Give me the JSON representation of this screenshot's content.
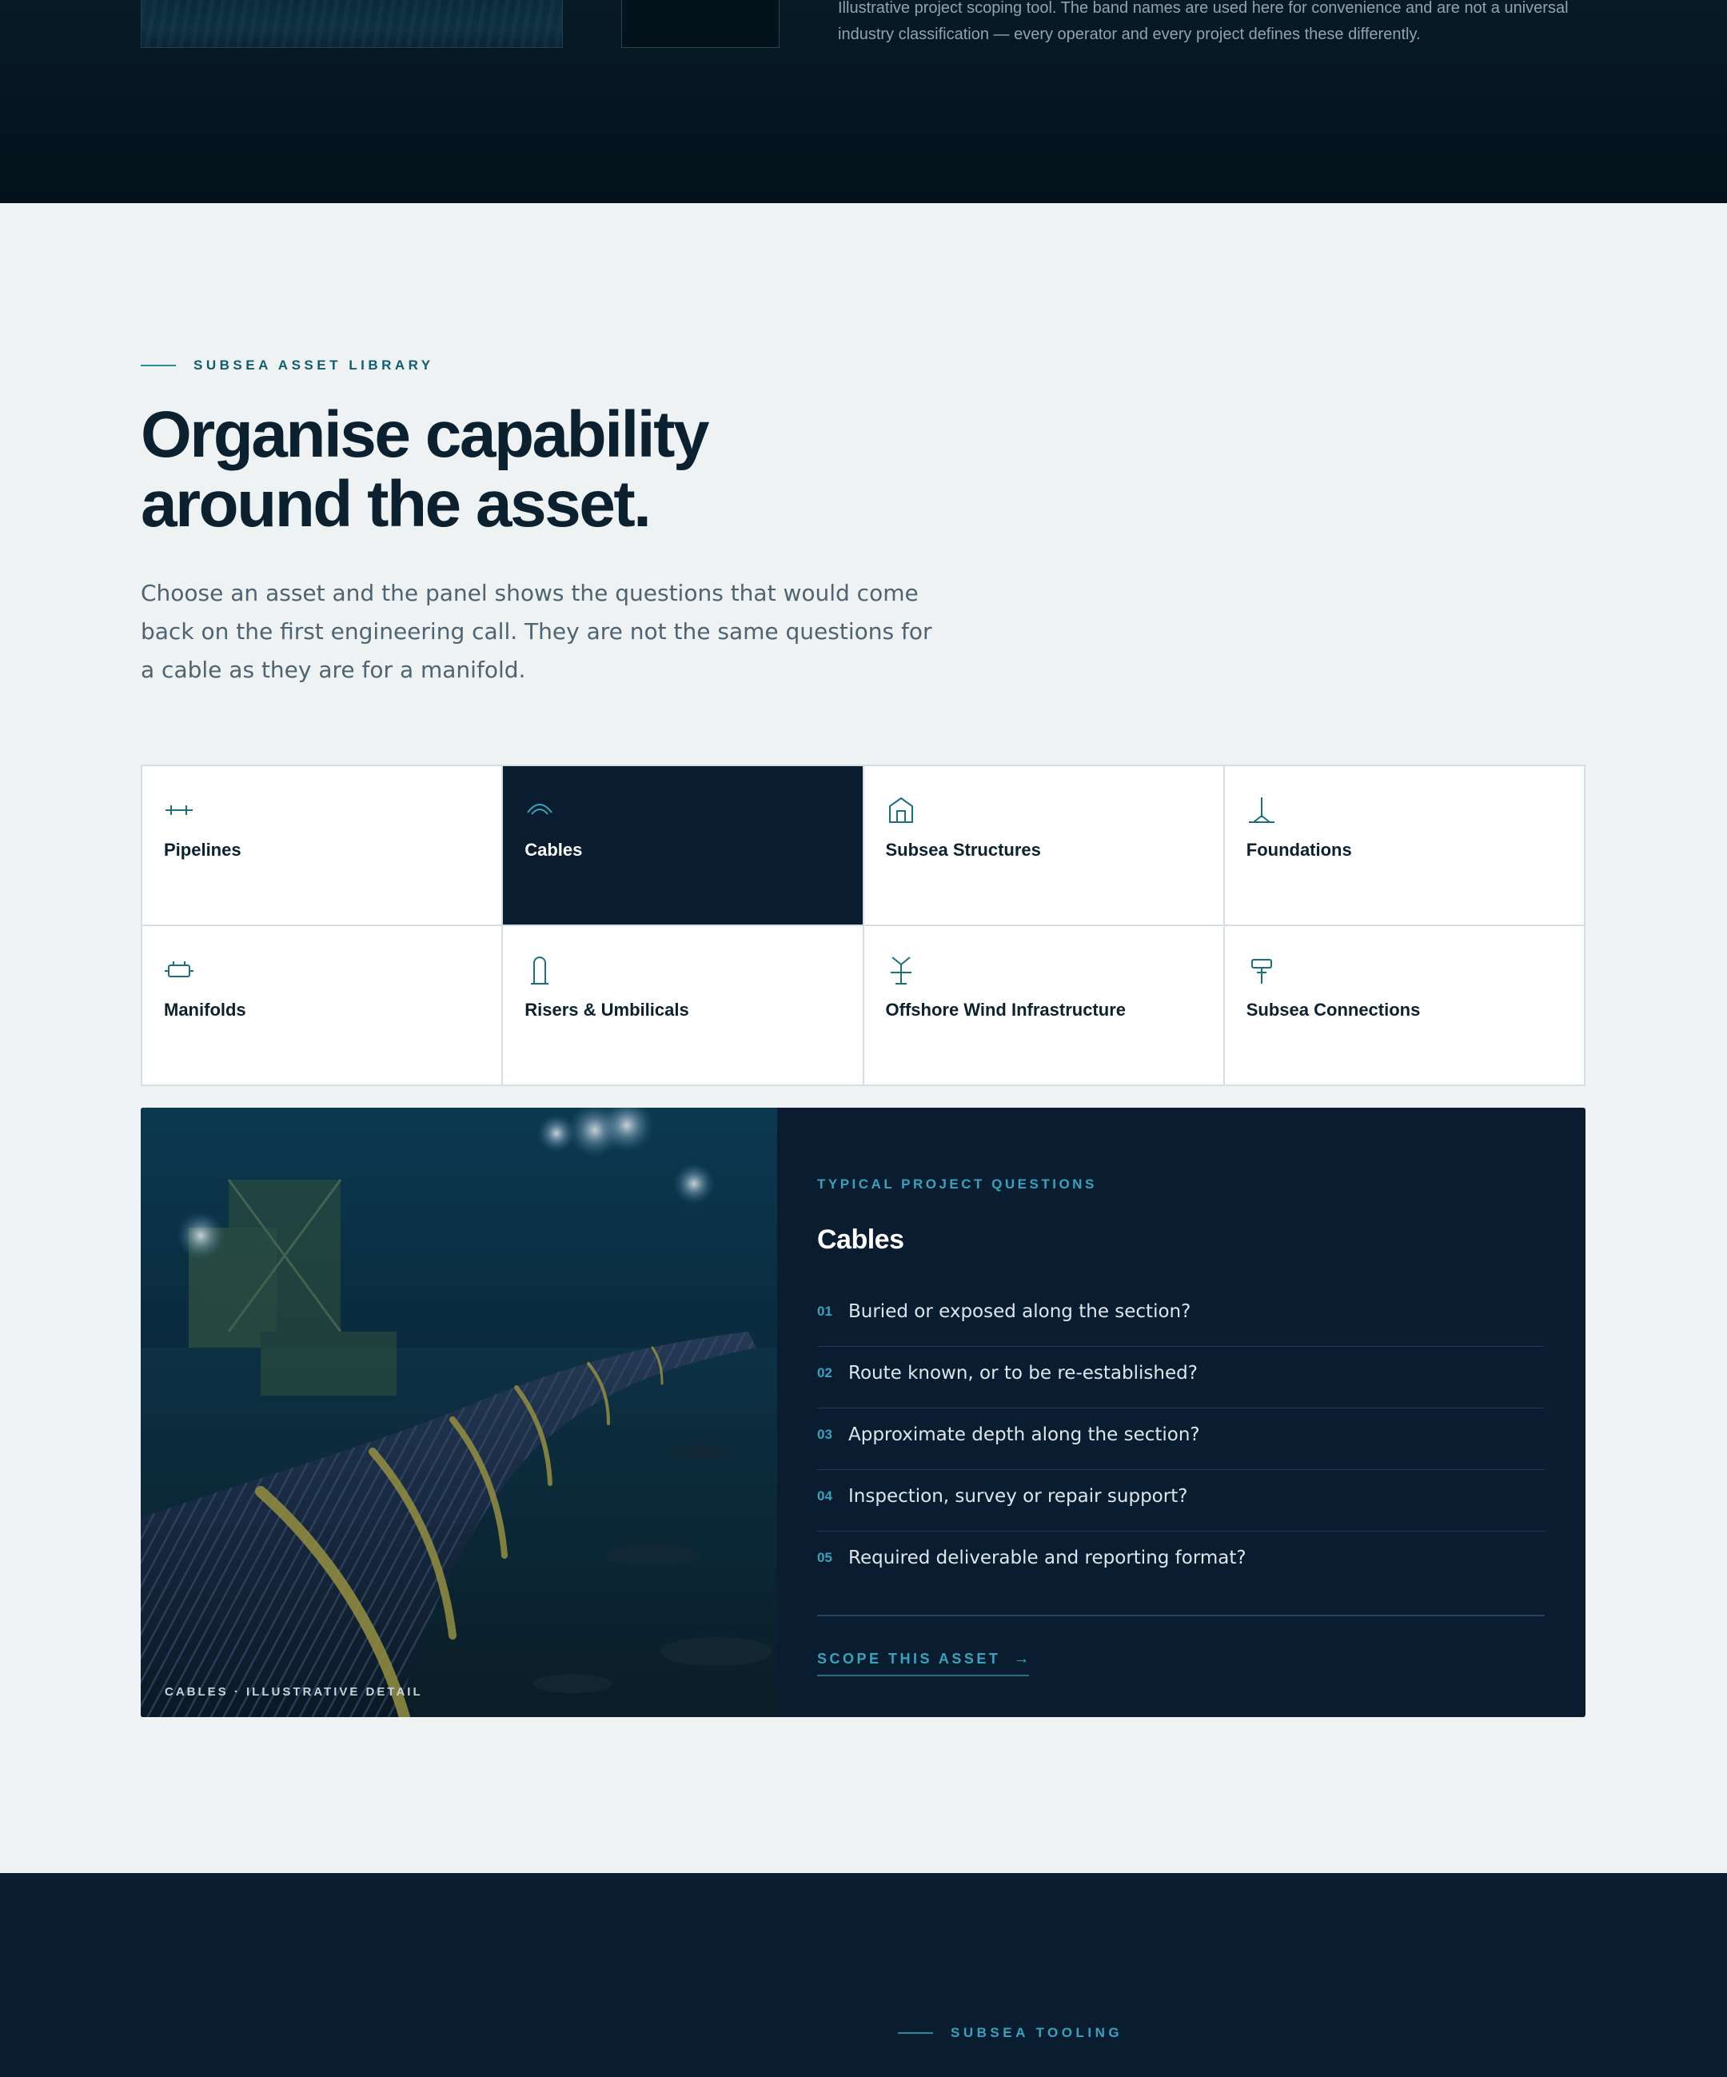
{
  "top_band": {
    "note": "Illustrative project scoping tool. The band names are used here for convenience and are not a universal industry classification — every operator and every project defines these differently."
  },
  "asset_library": {
    "eyebrow": "SUBSEA ASSET LIBRARY",
    "title_line1": "Organise capability",
    "title_line2": "around the asset.",
    "lead": "Choose an asset and the panel shows the questions that would come back on the first engineering call. They are not the same questions for a cable as they are for a manifold.",
    "assets": [
      {
        "label": "Pipelines",
        "icon": "pipeline-icon",
        "active": false
      },
      {
        "label": "Cables",
        "icon": "cable-icon",
        "active": true
      },
      {
        "label": "Subsea Structures",
        "icon": "structure-icon",
        "active": false
      },
      {
        "label": "Foundations",
        "icon": "foundation-icon",
        "active": false
      },
      {
        "label": "Manifolds",
        "icon": "manifold-icon",
        "active": false
      },
      {
        "label": "Risers & Umbilicals",
        "icon": "riser-icon",
        "active": false
      },
      {
        "label": "Offshore Wind Infrastructure",
        "icon": "wind-turbine-icon",
        "active": false
      },
      {
        "label": "Subsea Connections",
        "icon": "connector-icon",
        "active": false
      }
    ],
    "panel": {
      "image_caption": "CABLES · ILLUSTRATIVE DETAIL",
      "eyebrow": "TYPICAL PROJECT QUESTIONS",
      "title": "Cables",
      "questions": [
        {
          "num": "01",
          "text": "Buried or exposed along the section?"
        },
        {
          "num": "02",
          "text": "Route known, or to be re-established?"
        },
        {
          "num": "03",
          "text": "Approximate depth along the section?"
        },
        {
          "num": "04",
          "text": "Inspection, survey or repair support?"
        },
        {
          "num": "05",
          "text": "Required deliverable and reporting format?"
        }
      ],
      "cta_label": "SCOPE THIS ASSET",
      "cta_icon": "arrow-right-icon"
    }
  },
  "tooling": {
    "eyebrow": "SUBSEA TOOLING"
  },
  "colors": {
    "accent": "#37a3bd",
    "navy": "#0a1c30",
    "page_bg": "#eef2f3",
    "heading": "#0b2130"
  }
}
